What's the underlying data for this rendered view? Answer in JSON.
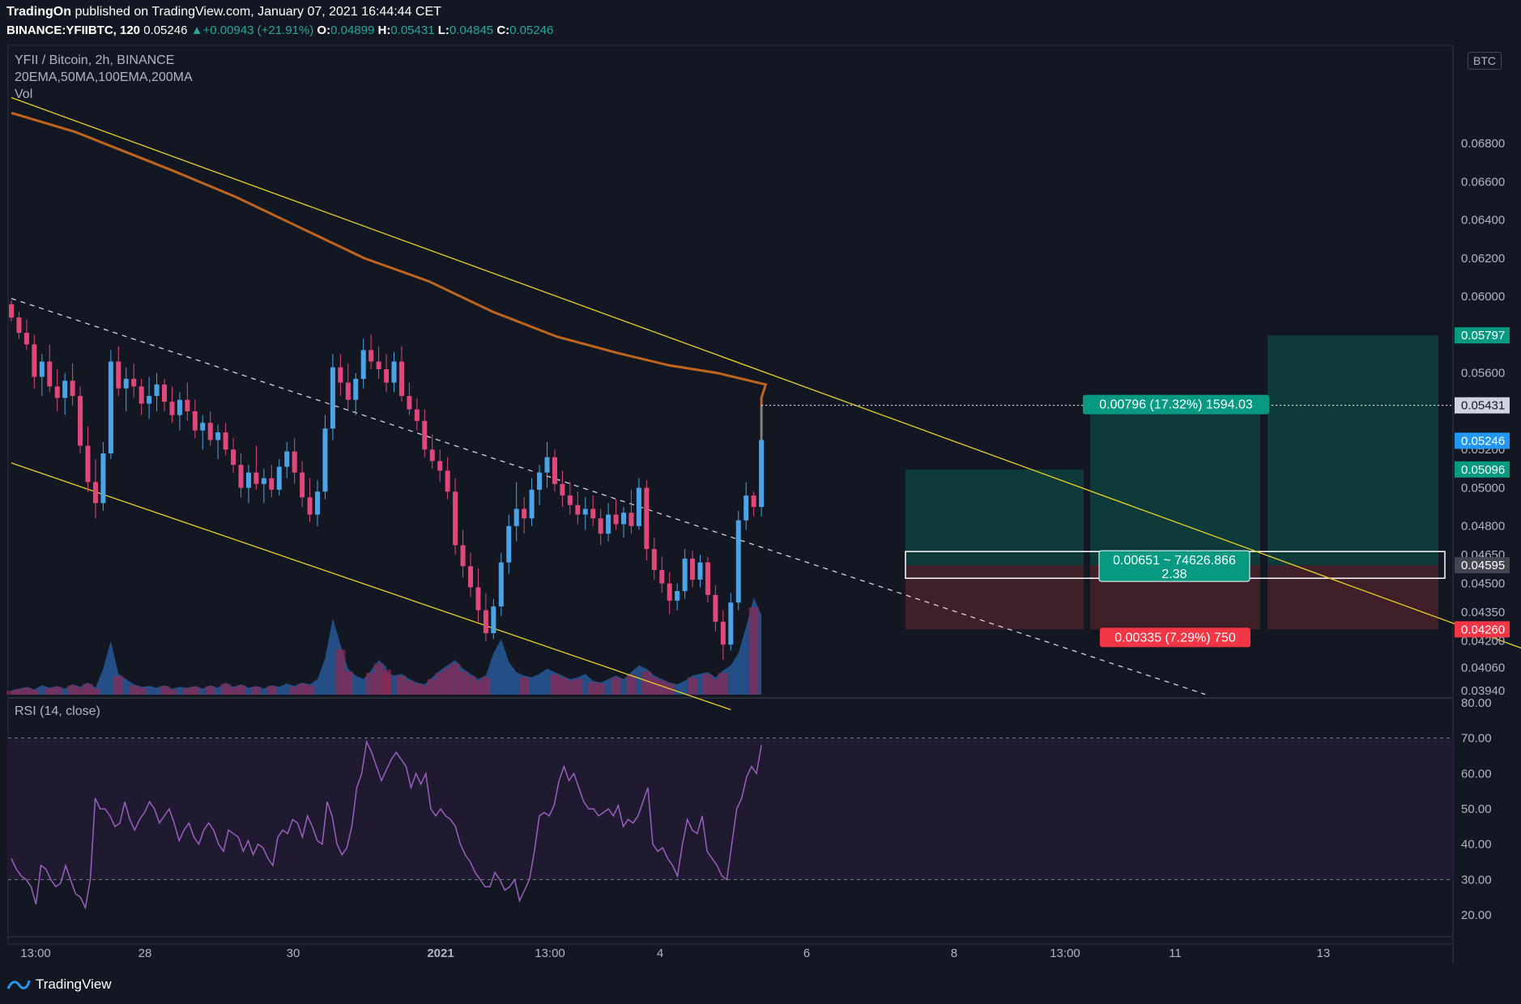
{
  "header": {
    "author": "TradingOn",
    "published_text": "published on TradingView.com, January 07, 2021 16:44:44 CET",
    "symbol": "BINANCE:YFIIBTC, 120",
    "last": "0.05246",
    "change": "+0.00943 (+21.91%)",
    "o_label": "O:",
    "o": "0.04899",
    "h_label": "H:",
    "h": "0.05431",
    "l_label": "L:",
    "l": "0.04845",
    "c_label": "C:",
    "c": "0.05246"
  },
  "legend": {
    "title": "YFII / Bitcoin, 2h, BINANCE",
    "indicators": "20EMA,50MA,100EMA,200MA",
    "volume": "Vol",
    "rsi": "RSI (14, close)"
  },
  "currency_badge": "BTC",
  "brand": "TradingView",
  "colors": {
    "background": "#131722",
    "up": "#4ca4e8",
    "down": "#e0477a",
    "ma": "#c0651e",
    "trendline": "#e6d21f",
    "rsi": "#9b5fc0",
    "target_zone": "#0f3a3a",
    "stop_zone": "#3f1f28",
    "target_tag": "#089981",
    "stop_tag": "#f23645",
    "last_tag": "#2196f3"
  },
  "price_axis": {
    "ticks": [
      "0.06800",
      "0.06600",
      "0.06400",
      "0.06200",
      "0.06000",
      "0.05600",
      "0.05200",
      "0.05000",
      "0.04800",
      "0.04650",
      "0.04500",
      "0.04350",
      "0.04200",
      "0.04060",
      "0.03940"
    ],
    "tags": {
      "target": "0.05797",
      "high": "0.05431",
      "last": "0.05246",
      "zone_top": "0.05096",
      "entry": "0.04595",
      "stop": "0.04260"
    }
  },
  "rsi_axis": {
    "ticks": [
      "80.00",
      "70.00",
      "60.00",
      "50.00",
      "40.00",
      "30.00",
      "20.00"
    ]
  },
  "time_axis": {
    "ticks": [
      "13:00",
      "28",
      "30",
      "2021",
      "13:00",
      "4",
      "6",
      "8",
      "13:00",
      "11",
      "13"
    ]
  },
  "position": {
    "target_label": "0.00796 (17.32%) 1594.03",
    "center_label_line1": "0.00651 ~ 74626.866",
    "center_label_line2": "2.38",
    "stop_label": "0.00335 (7.29%) 750"
  },
  "chart_data": {
    "type": "candlestick",
    "title": "YFII / Bitcoin, 2h, BINANCE",
    "interval": "2h",
    "y_range": [
      0.0391,
      0.0722
    ],
    "ohlc": [
      [
        0.0596,
        0.0598,
        0.0587,
        0.0589
      ],
      [
        0.0589,
        0.0592,
        0.0578,
        0.0581
      ],
      [
        0.0581,
        0.0588,
        0.0572,
        0.0575
      ],
      [
        0.0575,
        0.058,
        0.0552,
        0.0558
      ],
      [
        0.0558,
        0.057,
        0.0548,
        0.0566
      ],
      [
        0.0566,
        0.0575,
        0.055,
        0.0553
      ],
      [
        0.0553,
        0.0562,
        0.054,
        0.0547
      ],
      [
        0.0547,
        0.056,
        0.0538,
        0.0556
      ],
      [
        0.0556,
        0.0565,
        0.0543,
        0.0548
      ],
      [
        0.0548,
        0.0553,
        0.0518,
        0.0522
      ],
      [
        0.0522,
        0.0532,
        0.0498,
        0.0503
      ],
      [
        0.0503,
        0.0515,
        0.0484,
        0.0492
      ],
      [
        0.0492,
        0.0524,
        0.0488,
        0.0518
      ],
      [
        0.0518,
        0.0572,
        0.0515,
        0.0566
      ],
      [
        0.0566,
        0.0574,
        0.0548,
        0.0552
      ],
      [
        0.0552,
        0.0563,
        0.054,
        0.0557
      ],
      [
        0.0557,
        0.0565,
        0.0547,
        0.0553
      ],
      [
        0.0553,
        0.0557,
        0.0538,
        0.0544
      ],
      [
        0.0544,
        0.0558,
        0.0536,
        0.0548
      ],
      [
        0.0548,
        0.056,
        0.054,
        0.0554
      ],
      [
        0.0554,
        0.0557,
        0.054,
        0.0545
      ],
      [
        0.0545,
        0.0553,
        0.0534,
        0.0538
      ],
      [
        0.0538,
        0.055,
        0.053,
        0.0546
      ],
      [
        0.0546,
        0.0555,
        0.0535,
        0.054
      ],
      [
        0.054,
        0.0546,
        0.0526,
        0.053
      ],
      [
        0.053,
        0.0538,
        0.052,
        0.0534
      ],
      [
        0.0534,
        0.054,
        0.0522,
        0.0525
      ],
      [
        0.0525,
        0.0533,
        0.0515,
        0.0529
      ],
      [
        0.0529,
        0.0534,
        0.0517,
        0.052
      ],
      [
        0.052,
        0.0526,
        0.0508,
        0.0512
      ],
      [
        0.0512,
        0.0518,
        0.0495,
        0.05
      ],
      [
        0.05,
        0.0512,
        0.0492,
        0.0508
      ],
      [
        0.0508,
        0.0522,
        0.0499,
        0.0502
      ],
      [
        0.0502,
        0.051,
        0.0492,
        0.0505
      ],
      [
        0.0505,
        0.0512,
        0.0495,
        0.0499
      ],
      [
        0.0499,
        0.0515,
        0.0496,
        0.0511
      ],
      [
        0.0511,
        0.0524,
        0.0505,
        0.0519
      ],
      [
        0.0519,
        0.0526,
        0.0502,
        0.0508
      ],
      [
        0.0508,
        0.0514,
        0.049,
        0.0495
      ],
      [
        0.0495,
        0.0505,
        0.0482,
        0.0486
      ],
      [
        0.0486,
        0.0504,
        0.048,
        0.0498
      ],
      [
        0.0498,
        0.0538,
        0.0494,
        0.0531
      ],
      [
        0.0531,
        0.057,
        0.0525,
        0.0563
      ],
      [
        0.0563,
        0.057,
        0.0548,
        0.0555
      ],
      [
        0.0555,
        0.0565,
        0.054,
        0.0546
      ],
      [
        0.0546,
        0.056,
        0.0538,
        0.0557
      ],
      [
        0.0557,
        0.0578,
        0.0552,
        0.0572
      ],
      [
        0.0572,
        0.058,
        0.0562,
        0.0566
      ],
      [
        0.0566,
        0.0574,
        0.0557,
        0.0562
      ],
      [
        0.0562,
        0.057,
        0.055,
        0.0555
      ],
      [
        0.0555,
        0.0571,
        0.055,
        0.0566
      ],
      [
        0.0566,
        0.0574,
        0.0545,
        0.0548
      ],
      [
        0.0548,
        0.0555,
        0.0538,
        0.0541
      ],
      [
        0.0541,
        0.0547,
        0.053,
        0.0535
      ],
      [
        0.0535,
        0.0541,
        0.0516,
        0.052
      ],
      [
        0.052,
        0.0528,
        0.051,
        0.0514
      ],
      [
        0.0514,
        0.052,
        0.0503,
        0.0509
      ],
      [
        0.0509,
        0.0516,
        0.0494,
        0.0498
      ],
      [
        0.0498,
        0.0505,
        0.0465,
        0.047
      ],
      [
        0.047,
        0.0478,
        0.0453,
        0.0459
      ],
      [
        0.0459,
        0.0466,
        0.0443,
        0.0448
      ],
      [
        0.0448,
        0.0458,
        0.043,
        0.0436
      ],
      [
        0.0436,
        0.0445,
        0.042,
        0.0424
      ],
      [
        0.0424,
        0.0442,
        0.0421,
        0.0438
      ],
      [
        0.0438,
        0.0466,
        0.0433,
        0.0461
      ],
      [
        0.0461,
        0.0486,
        0.0455,
        0.048
      ],
      [
        0.048,
        0.0503,
        0.0472,
        0.0489
      ],
      [
        0.0489,
        0.0495,
        0.0476,
        0.0484
      ],
      [
        0.0484,
        0.0505,
        0.048,
        0.0499
      ],
      [
        0.0499,
        0.0512,
        0.0491,
        0.0508
      ],
      [
        0.0508,
        0.0524,
        0.05,
        0.0516
      ],
      [
        0.0516,
        0.052,
        0.0498,
        0.0502
      ],
      [
        0.0502,
        0.0509,
        0.049,
        0.0496
      ],
      [
        0.0496,
        0.0503,
        0.0486,
        0.0491
      ],
      [
        0.0491,
        0.0498,
        0.0481,
        0.0486
      ],
      [
        0.0486,
        0.0495,
        0.0478,
        0.0489
      ],
      [
        0.0489,
        0.0496,
        0.048,
        0.0484
      ],
      [
        0.0484,
        0.0489,
        0.047,
        0.0476
      ],
      [
        0.0476,
        0.0492,
        0.0472,
        0.0486
      ],
      [
        0.0486,
        0.0494,
        0.0478,
        0.0481
      ],
      [
        0.0481,
        0.049,
        0.0474,
        0.0487
      ],
      [
        0.0487,
        0.0499,
        0.0476,
        0.048
      ],
      [
        0.048,
        0.0505,
        0.0478,
        0.05
      ],
      [
        0.05,
        0.0504,
        0.0462,
        0.0468
      ],
      [
        0.0468,
        0.0474,
        0.0452,
        0.0457
      ],
      [
        0.0457,
        0.0464,
        0.0445,
        0.045
      ],
      [
        0.045,
        0.0456,
        0.0434,
        0.0441
      ],
      [
        0.0441,
        0.045,
        0.0436,
        0.0446
      ],
      [
        0.0446,
        0.0468,
        0.0442,
        0.0463
      ],
      [
        0.0463,
        0.0467,
        0.0448,
        0.0452
      ],
      [
        0.0452,
        0.0465,
        0.0448,
        0.0461
      ],
      [
        0.0461,
        0.0464,
        0.044,
        0.0444
      ],
      [
        0.0444,
        0.0449,
        0.0425,
        0.043
      ],
      [
        0.043,
        0.0436,
        0.041,
        0.0418
      ],
      [
        0.0418,
        0.0445,
        0.0415,
        0.044
      ],
      [
        0.044,
        0.0488,
        0.0436,
        0.0483
      ],
      [
        0.0483,
        0.0503,
        0.0478,
        0.0496
      ],
      [
        0.0496,
        0.0498,
        0.0485,
        0.049
      ],
      [
        0.049,
        0.0543,
        0.0485,
        0.0525
      ]
    ],
    "volume_peak_values": "relative",
    "volume": [
      5,
      7,
      9,
      6,
      11,
      8,
      10,
      7,
      12,
      9,
      14,
      8,
      30,
      62,
      24,
      18,
      12,
      9,
      10,
      8,
      11,
      7,
      9,
      8,
      10,
      7,
      11,
      8,
      14,
      9,
      12,
      8,
      10,
      7,
      11,
      9,
      13,
      10,
      14,
      12,
      18,
      42,
      88,
      58,
      30,
      22,
      18,
      28,
      40,
      32,
      26,
      22,
      24,
      18,
      14,
      12,
      20,
      28,
      34,
      40,
      30,
      24,
      18,
      22,
      48,
      64,
      38,
      26,
      22,
      20,
      24,
      30,
      26,
      22,
      18,
      20,
      24,
      16,
      14,
      18,
      22,
      18,
      26,
      34,
      30,
      22,
      18,
      14,
      12,
      16,
      22,
      24,
      26,
      20,
      28,
      34,
      48,
      78,
      112,
      92
    ],
    "ma_line": [
      [
        0,
        0.0696
      ],
      [
        8,
        0.0686
      ],
      [
        14,
        0.0676
      ],
      [
        20,
        0.0666
      ],
      [
        28,
        0.0652
      ],
      [
        36,
        0.0636
      ],
      [
        44,
        0.062
      ],
      [
        52,
        0.0608
      ],
      [
        60,
        0.0592
      ],
      [
        68,
        0.0579
      ],
      [
        76,
        0.057
      ],
      [
        82,
        0.0564
      ],
      [
        88,
        0.056
      ],
      [
        94,
        0.0554
      ],
      [
        100,
        0.0547
      ],
      [
        104,
        0.0541
      ],
      [
        108,
        0.0534
      ],
      [
        114,
        0.0524
      ],
      [
        120,
        0.0516
      ],
      [
        126,
        0.051
      ],
      [
        132,
        0.0504
      ],
      [
        138,
        0.0498
      ],
      [
        141,
        0.0495
      ],
      [
        143,
        0.0494
      ]
    ],
    "trendline_upper_start": [
      0.0704,
      0
    ],
    "trendline_upper_end": [
      0.0386,
      218
    ],
    "trendline_lower_start": [
      0.0513,
      0
    ],
    "trendline_lower_end": [
      0.0384,
      94
    ],
    "channel_mid_start": [
      0.0599,
      0
    ],
    "channel_mid_end": [
      0.0392,
      156
    ],
    "long_position": {
      "entry": 0.04595,
      "target": 0.05797,
      "stop": 0.0426,
      "risk_reward": "2.38"
    },
    "rsi": [
      36,
      33,
      31,
      30,
      28,
      23,
      34,
      33,
      30,
      28,
      29,
      34,
      30,
      26,
      25,
      22,
      30,
      53,
      50,
      50,
      48,
      45,
      46,
      52,
      47,
      44,
      47,
      49,
      52,
      50,
      46,
      48,
      50,
      46,
      41,
      44,
      46,
      42,
      40,
      44,
      46,
      44,
      40,
      38,
      44,
      43,
      42,
      38,
      41,
      37,
      40,
      39,
      36,
      34,
      42,
      44,
      43,
      47,
      46,
      42,
      48,
      45,
      41,
      40,
      52,
      48,
      40,
      37,
      39,
      45,
      56,
      60,
      69,
      66,
      62,
      58,
      61,
      64,
      66,
      64,
      62,
      56,
      60,
      57,
      60,
      50,
      48,
      50,
      48,
      47,
      45,
      40,
      37,
      35,
      32,
      30,
      28,
      28,
      32,
      30,
      27,
      28,
      30,
      24,
      27,
      30,
      38,
      48,
      49,
      48,
      51,
      58,
      62,
      58,
      60,
      56,
      52,
      50,
      50,
      48,
      49,
      50,
      48,
      51,
      45,
      47,
      46,
      48,
      52,
      56,
      40,
      38,
      39,
      36,
      34,
      31,
      40,
      47,
      44,
      43,
      48,
      38,
      36,
      34,
      31,
      30,
      40,
      50,
      53,
      59,
      62,
      60,
      68
    ]
  }
}
